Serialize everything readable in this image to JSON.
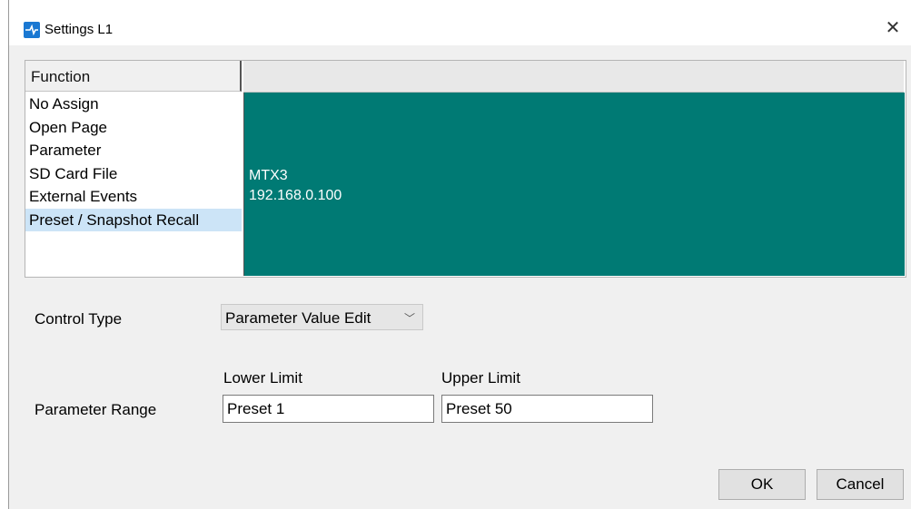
{
  "window": {
    "title": "Settings L1"
  },
  "function_panel": {
    "header": "Function",
    "items": [
      "No Assign",
      "Open Page",
      "Parameter",
      "SD Card File",
      "External Events",
      "Preset / Snapshot Recall"
    ],
    "selected": "Preset / Snapshot Recall",
    "detail": {
      "device": "MTX3",
      "ip": "192.168.0.100",
      "color": "#007a74"
    }
  },
  "control_type": {
    "label": "Control Type",
    "value": "Parameter Value Edit"
  },
  "parameter_range": {
    "label": "Parameter Range",
    "lower_label": "Lower Limit",
    "upper_label": "Upper Limit",
    "lower_value": "Preset 1",
    "upper_value": "Preset 50"
  },
  "buttons": {
    "ok": "OK",
    "cancel": "Cancel"
  },
  "icons": {
    "app": "settings-app-icon",
    "close": "close-icon",
    "dropdown": "chevron-down-icon"
  }
}
